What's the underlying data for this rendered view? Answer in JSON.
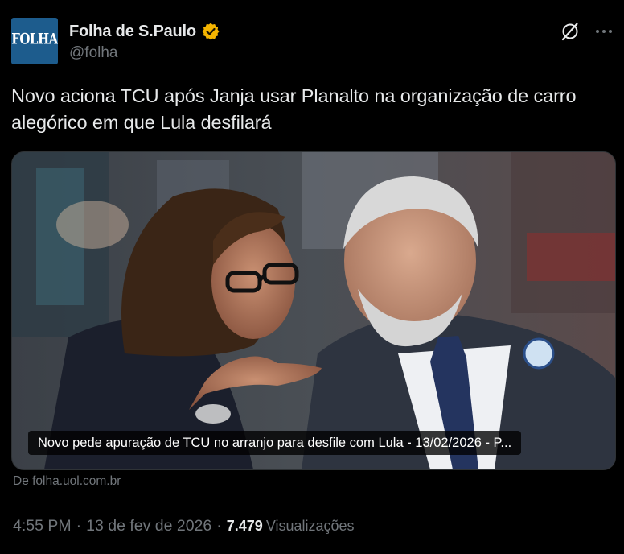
{
  "author": {
    "avatar_text": "FOLHA",
    "display_name": "Folha de S.Paulo",
    "handle": "@folha",
    "verified_color": "#f4b400"
  },
  "header_actions": {
    "grok_icon": "grok-icon",
    "more_icon": "more-dots-icon"
  },
  "tweet": {
    "text": "Novo aciona TCU após Janja usar Planalto na organização de carro alegórico em que Lula desfilará"
  },
  "card": {
    "caption": "Novo pede apuração de TCU no arranjo para desfile com Lula - 13/02/2026 - P...",
    "source": "De folha.uol.com.br"
  },
  "meta": {
    "time": "4:55 PM",
    "separator": "·",
    "date": "13 de fev de 2026",
    "views_count": "7.479",
    "views_label": "Visualizações"
  },
  "colors": {
    "background": "#000000",
    "text_primary": "#e7e9ea",
    "text_secondary": "#71767b",
    "border": "#2f3336",
    "avatar_bg": "#1d5c8d"
  }
}
